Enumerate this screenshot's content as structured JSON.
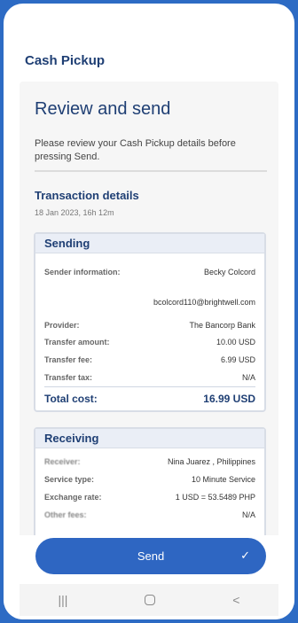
{
  "header": {
    "title": "Cash Pickup"
  },
  "page": {
    "title": "Review and send",
    "subtitle": "Please review your Cash Pickup details before pressing Send."
  },
  "transaction": {
    "heading": "Transaction details",
    "timestamp": "18 Jan 2023, 16h 12m"
  },
  "sending": {
    "title": "Sending",
    "sender_label": "Sender information:",
    "sender_name": "Becky Colcord",
    "sender_email": "bcolcord110@brightwell.com",
    "provider_label": "Provider:",
    "provider_value": "The Bancorp Bank",
    "amount_label": "Transfer amount:",
    "amount_value": "10.00 USD",
    "fee_label": "Transfer fee:",
    "fee_value": "6.99 USD",
    "tax_label": "Transfer tax:",
    "tax_value": "N/A",
    "total_label": "Total cost:",
    "total_value": "16.99 USD"
  },
  "receiving": {
    "title": "Receiving",
    "receiver_label": "Receiver:",
    "receiver_value": "Nina Juarez , Philippines",
    "service_label": "Service type:",
    "service_value": "10 Minute Service",
    "rate_label": "Exchange rate:",
    "rate_value": "1 USD = 53.5489 PHP",
    "other_label": "Other fees:",
    "other_value": "N/A"
  },
  "actions": {
    "send_label": "Send",
    "send_icon": "check-icon"
  },
  "nav": {
    "recents_glyph": "|||",
    "back_glyph": "<"
  }
}
